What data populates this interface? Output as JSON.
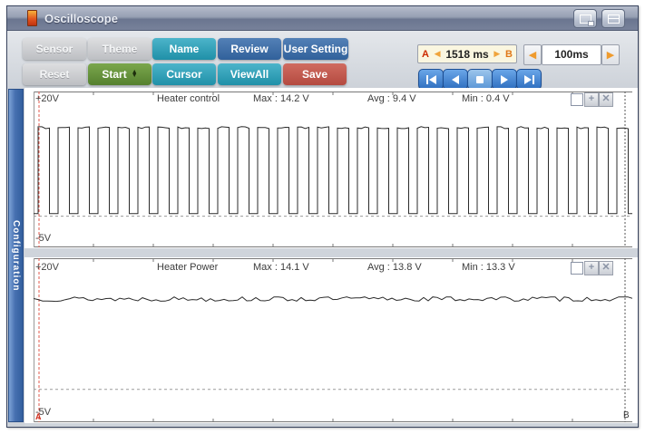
{
  "titlebar": {
    "title": "Oscilloscope",
    "app_icon": "oscilloscope-probe-icon",
    "buttons": [
      {
        "name": "popout-window-button",
        "icon": "window-popout-icon"
      },
      {
        "name": "shade-window-button",
        "icon": "window-shade-icon"
      }
    ]
  },
  "toolbar": {
    "rows": [
      {
        "buttons": [
          {
            "label": "Sensor",
            "style": "gray"
          },
          {
            "label": "Theme",
            "style": "gray"
          },
          {
            "label": "Name",
            "style": "teal"
          },
          {
            "label": "Review",
            "style": "blue"
          },
          {
            "label": "User Setting",
            "style": "blue"
          }
        ]
      },
      {
        "buttons": [
          {
            "label": "Reset",
            "style": "gray"
          },
          {
            "label": "Start",
            "style": "green",
            "spinner": true
          },
          {
            "label": "Cursor",
            "style": "teal"
          },
          {
            "label": "ViewAll",
            "style": "teal"
          },
          {
            "label": "Save",
            "style": "red"
          }
        ]
      }
    ],
    "ab_box": {
      "a_label": "A",
      "b_label": "B",
      "value": "1518 ms"
    },
    "timebase": {
      "value": "100ms"
    },
    "transport": [
      "skip-to-start",
      "step-back",
      "stop",
      "play",
      "skip-to-end"
    ]
  },
  "sidebar": {
    "tab_label": "Configuration"
  },
  "charts": [
    {
      "title": "Heater control",
      "range_top_label": "+20V",
      "range_bottom_label": "-5V",
      "max_label": "Max : 14.2 V",
      "avg_label": "Avg : 9.4 V",
      "min_label": "Min : 0.4 V",
      "controls": [
        "select-checkbox",
        "add-channel",
        "close-channel"
      ]
    },
    {
      "title": "Heater Power",
      "range_top_label": "+20V",
      "range_bottom_label": "-5V",
      "max_label": "Max : 14.1 V",
      "avg_label": "Avg : 13.8 V",
      "min_label": "Min : 13.3 V",
      "controls": [
        "select-checkbox",
        "add-channel",
        "close-channel"
      ]
    }
  ],
  "cursors": {
    "a_label": "A",
    "b_label": "B"
  },
  "colors": {
    "teal_button": "#2f9fb8",
    "blue_button": "#3c6ba5",
    "green_button": "#638d3c",
    "red_button": "#c05a50",
    "gray_button": "#c9cbce",
    "transport_blue": "#3c7cc8",
    "cursor_a": "#e0584c",
    "cursor_b": "#555555",
    "config_tab_blue": "#3f6fb2",
    "accent_orange": "#f0a43c",
    "ab_a_text": "#cc2a00",
    "ab_value_bg": "#faf6e0"
  },
  "chart_data": [
    {
      "type": "line",
      "title": "Heater control",
      "waveform": "square",
      "ylim": [
        -5,
        20
      ],
      "x_span_ms": 1518,
      "timebase_per_div": "100ms",
      "high_v": 14.2,
      "low_v": 0.4,
      "duty": 0.57,
      "cycles": 30,
      "zero_ref_line": 0,
      "stats": {
        "max": 14.2,
        "avg": 9.4,
        "min": 0.4
      }
    },
    {
      "type": "line",
      "title": "Heater Power",
      "waveform": "noisy-dc",
      "ylim": [
        -5,
        20
      ],
      "x_span_ms": 1518,
      "timebase_per_div": "100ms",
      "level_v": 13.8,
      "noise_v": 0.5,
      "zero_ref_line": 0,
      "stats": {
        "max": 14.1,
        "avg": 13.8,
        "min": 13.3
      }
    }
  ]
}
